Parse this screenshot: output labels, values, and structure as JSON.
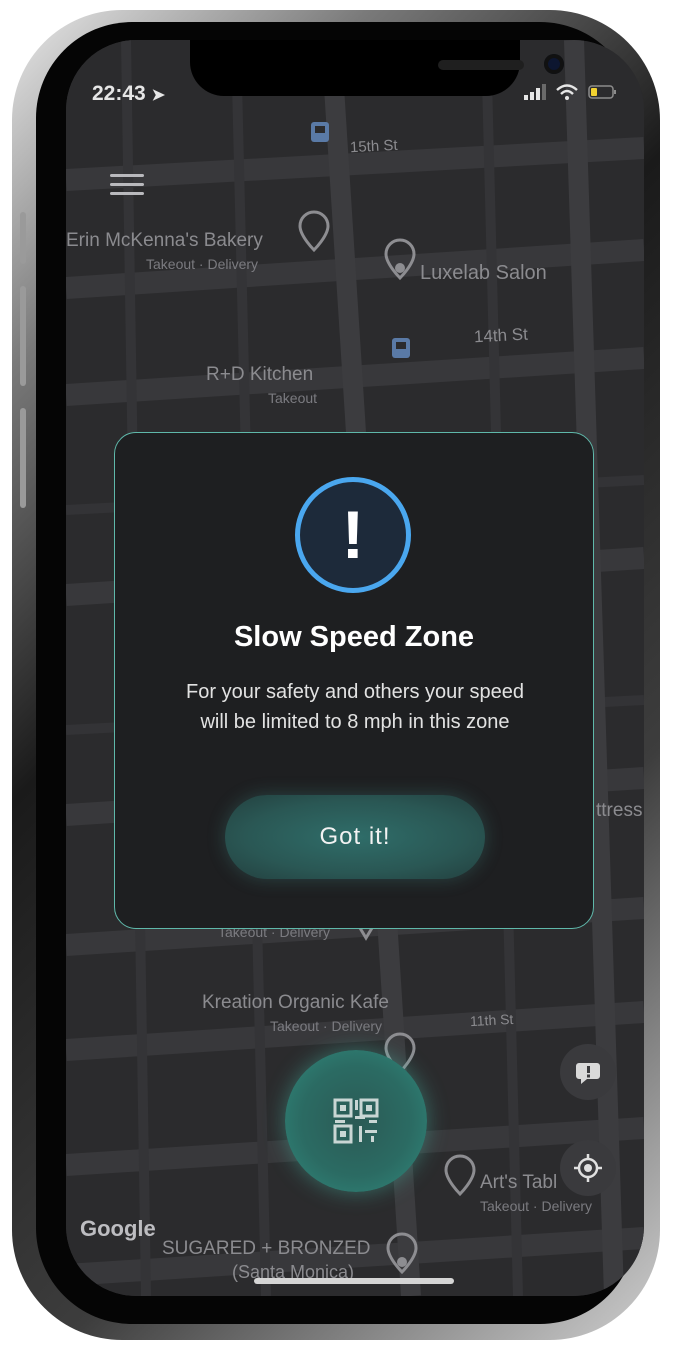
{
  "status_bar": {
    "time": "22:43"
  },
  "map": {
    "labels": {
      "street_15th": "15th St",
      "street_14th": "14th St",
      "street_11th": "11th St",
      "erin": "Erin McKenna's Bakery",
      "erin_sub": "Takeout · Delivery",
      "luxelab": "Luxelab Salon",
      "rd_kitchen": "R+D Kitchen",
      "rd_kitchen_sub": "Takeout",
      "kreation": "Kreation Organic Kafe",
      "kreation_sub": "Takeout · Delivery",
      "hidden_sub": "Takeout · Delivery",
      "arts": "Art's Tabl",
      "arts_sub": "Takeout · Delivery",
      "sugared": "SUGARED + BRONZED",
      "sugared_sub": "(Santa Monica)",
      "mattress": "ttress",
      "google": "Google"
    }
  },
  "modal": {
    "title": "Slow Speed Zone",
    "message": "For your safety and others your speed will be limited to 8 mph in this zone",
    "button": "Got it!"
  },
  "colors": {
    "accent_teal": "#5fb8aa",
    "alert_blue": "#4aa7ef",
    "map_bg": "#2c2c2e"
  },
  "icons": [
    "location-arrow-icon",
    "signal-icon",
    "wifi-icon",
    "battery-icon",
    "menu-icon",
    "alert-icon",
    "qr-code-icon",
    "chat-alert-icon",
    "locate-me-icon",
    "bus-stop-icon",
    "restaurant-pin-icon",
    "place-pin-icon"
  ]
}
